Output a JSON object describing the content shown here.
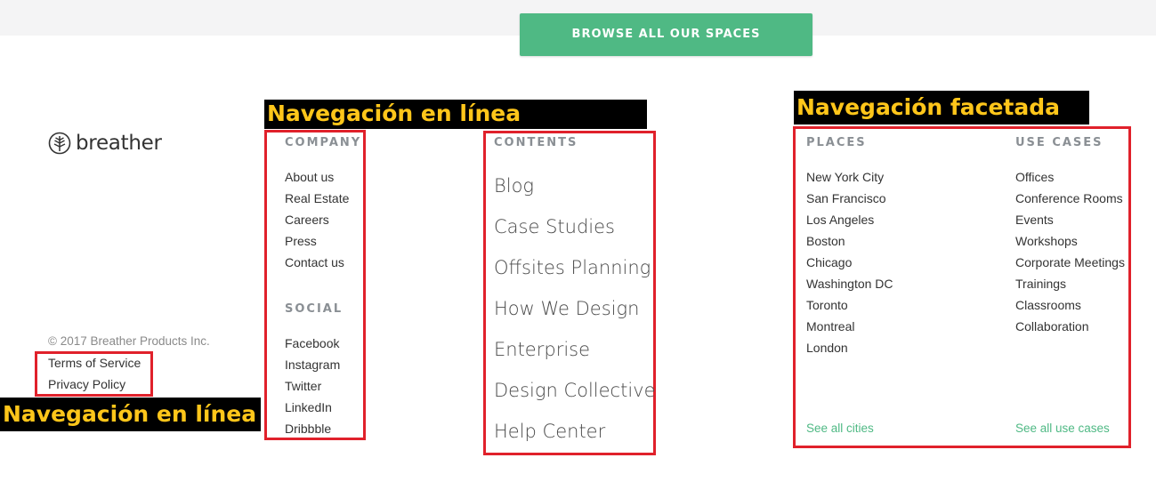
{
  "cta": {
    "label": "BROWSE ALL OUR SPACES"
  },
  "brand": {
    "name": "breather",
    "accent": "#4fb984",
    "annotation_red": "#e0212b",
    "annotation_yellow": "#ffc61a"
  },
  "footer": {
    "copyright": "© 2017 Breather Products Inc.",
    "legal": [
      "Terms of Service",
      "Privacy Policy"
    ]
  },
  "annotations": {
    "inline_nav_top": "Navegación en línea",
    "inline_nav_bottom": "Navegación en línea",
    "faceted_nav": "Navegación facetada"
  },
  "company": {
    "heading": "COMPANY",
    "items": [
      "About us",
      "Real Estate",
      "Careers",
      "Press",
      "Contact us"
    ]
  },
  "social": {
    "heading": "SOCIAL",
    "items": [
      "Facebook",
      "Instagram",
      "Twitter",
      "LinkedIn",
      "Dribbble"
    ]
  },
  "contents": {
    "heading": "CONTENTS",
    "items": [
      "Blog",
      "Case Studies",
      "Offsites Planning",
      "How We Design",
      "Enterprise",
      "Design Collective",
      "Help Center"
    ]
  },
  "places": {
    "heading": "PLACES",
    "items": [
      "New York City",
      "San Francisco",
      "Los Angeles",
      "Boston",
      "Chicago",
      "Washington DC",
      "Toronto",
      "Montreal",
      "London"
    ],
    "see_all": "See all cities"
  },
  "use_cases": {
    "heading": "USE CASES",
    "items": [
      "Offices",
      "Conference Rooms",
      "Events",
      "Workshops",
      "Corporate Meetings",
      "Trainings",
      "Classrooms",
      "Collaboration"
    ],
    "see_all": "See all use cases"
  }
}
